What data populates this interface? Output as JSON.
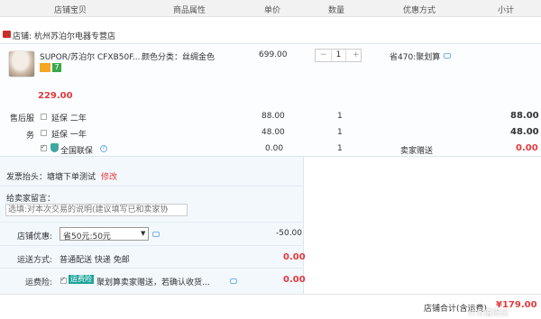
{
  "header": {
    "col_item": "店铺宝贝",
    "col_attr": "商品属性",
    "col_price": "单价",
    "col_qty": "数量",
    "col_promo": "优惠方式",
    "col_subtotal": "小计"
  },
  "shop": {
    "label": "店铺:",
    "name": "杭州苏泊尔电器专营店"
  },
  "product": {
    "title": "SUPOR/苏泊尔 CFXB50F...",
    "badge_num": "7",
    "attr": "颜色分类：丝绸金色",
    "price": "699.00",
    "qty": "1",
    "qty_minus": "−",
    "qty_plus": "+",
    "promo": "省470:聚划算",
    "final_price": "229.00"
  },
  "services": {
    "label_top": "售后服",
    "label_bottom": "务",
    "rows": [
      {
        "name": "延保 二年",
        "price": "88.00",
        "qty": "1",
        "promo": "",
        "subtotal": "88.00"
      },
      {
        "name": "延保 一年",
        "price": "48.00",
        "qty": "1",
        "promo": "",
        "subtotal": "48.00"
      },
      {
        "name": "全国联保",
        "price": "0.00",
        "qty": "1",
        "promo": "卖家赠送",
        "subtotal": "0.00"
      }
    ]
  },
  "invoice": {
    "label": "发票抬头：",
    "value": "塘塘下单测试",
    "edit": "修改"
  },
  "message": {
    "label": "给卖家留言：",
    "placeholder": "选填:对本次交易的说明(建议填写已和卖家协"
  },
  "discount": {
    "label": "店铺优惠:",
    "selected": "省50元:50元",
    "value": "-50.00"
  },
  "shipping": {
    "label": "运送方式:",
    "value": "普通配送 快递 免邮",
    "cost": "0.00"
  },
  "insurance": {
    "label": "运费险:",
    "tag": "运费险",
    "text": "聚划算卖家赠送，若确认收货...",
    "cost": "0.00"
  },
  "total": {
    "label": "店铺合计(含运费)",
    "value": "¥179.00"
  },
  "watermark": "什么值得买",
  "colors": {
    "red": "#e4393c",
    "teal": "#1aa39a",
    "blue": "#3c8bd6"
  }
}
